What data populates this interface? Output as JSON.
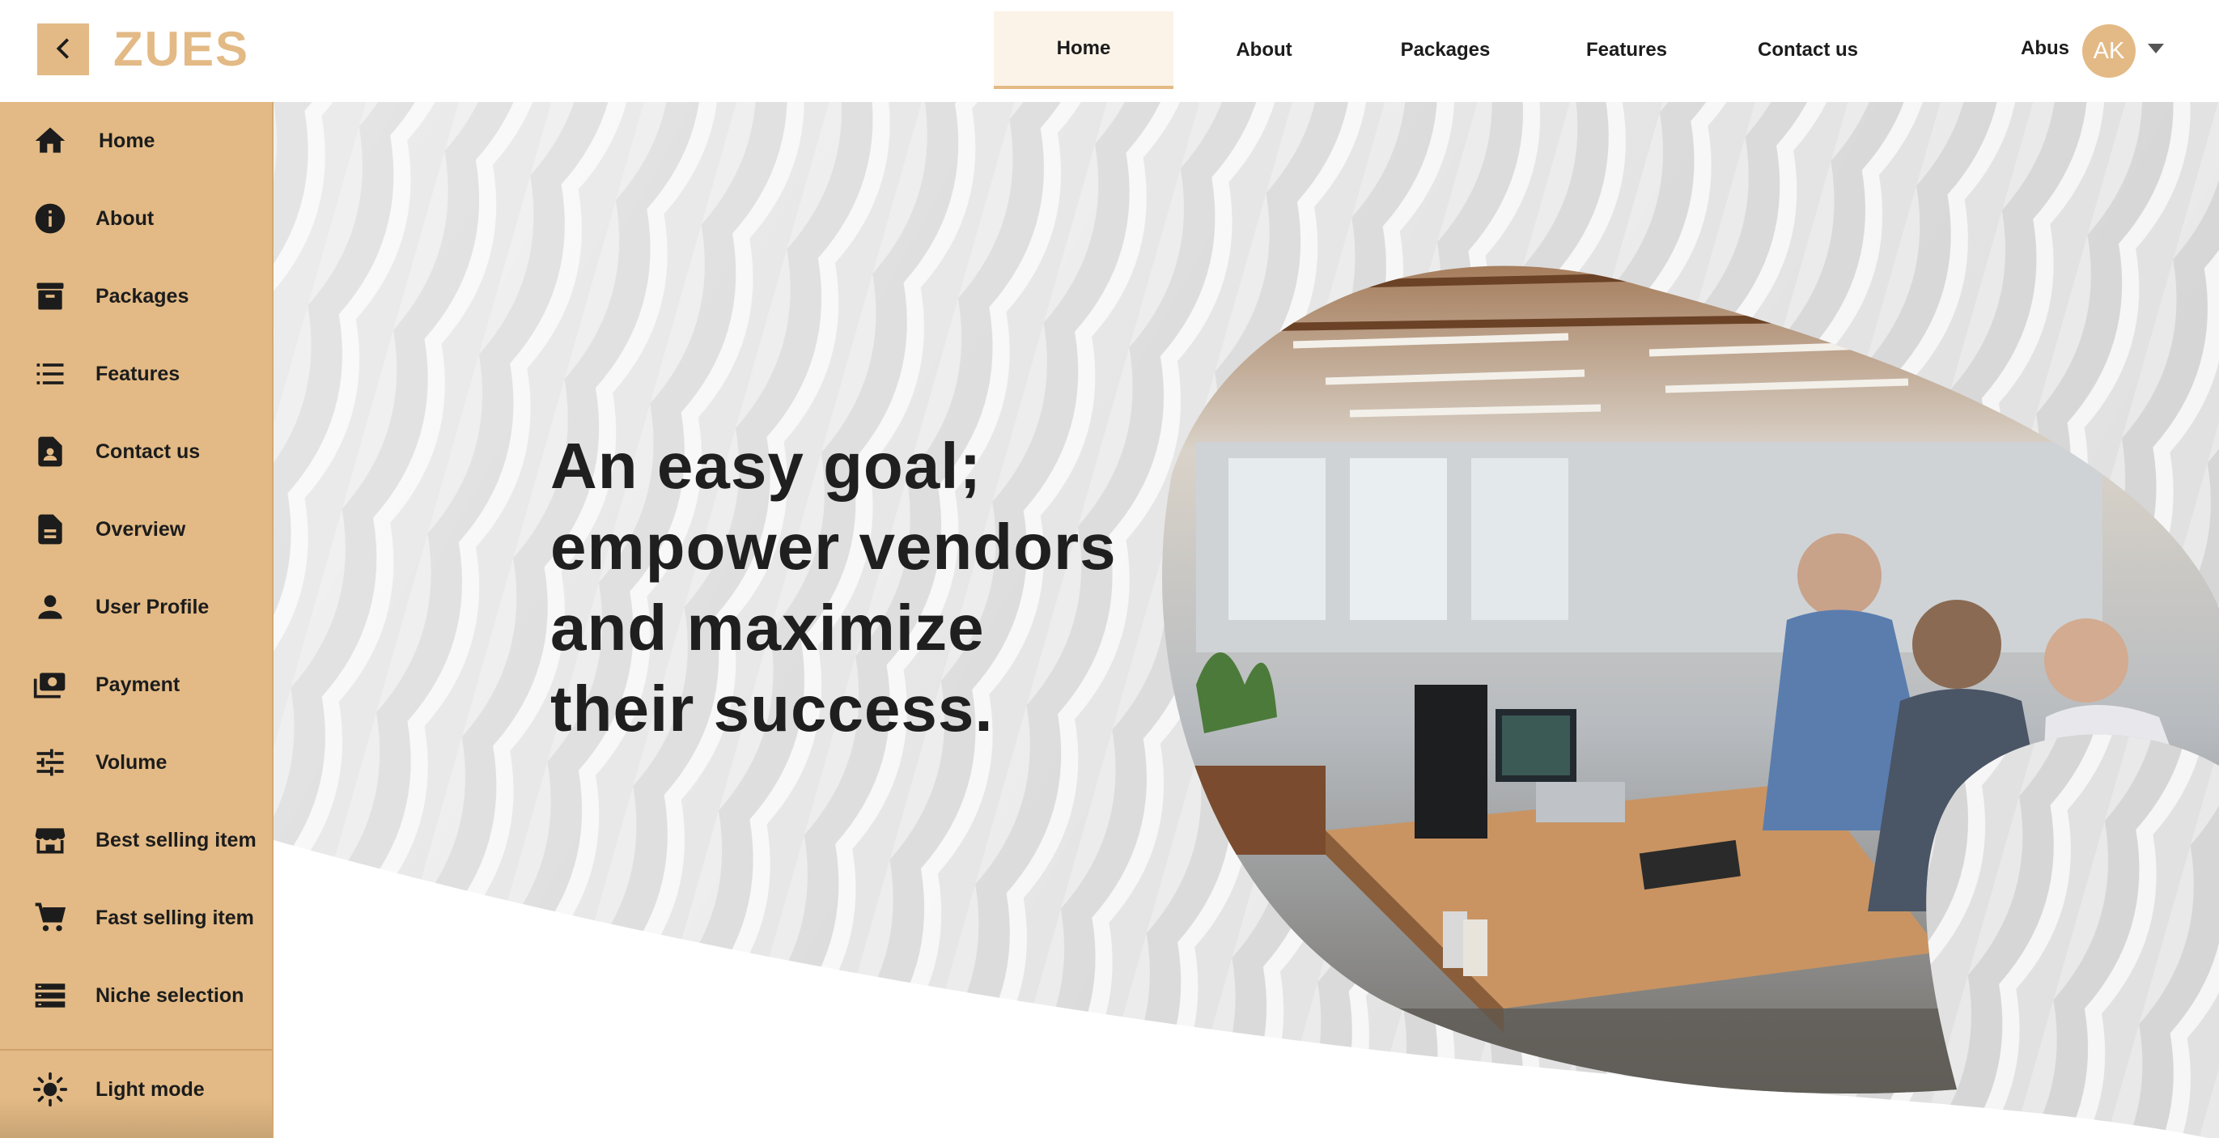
{
  "brand": {
    "name": "ZUES",
    "accent": "#e3ba85"
  },
  "header": {
    "back_icon": "chevron-left-icon",
    "tabs": [
      {
        "label": "Home",
        "active": true
      },
      {
        "label": "About",
        "active": false
      },
      {
        "label": "Packages",
        "active": false
      },
      {
        "label": "Features",
        "active": false
      },
      {
        "label": "Contact us",
        "active": false
      }
    ],
    "user": {
      "name": "Abus",
      "initials": "AK"
    }
  },
  "sidebar": {
    "items": [
      {
        "label": "Home",
        "icon": "home-icon"
      },
      {
        "label": "About",
        "icon": "info-icon"
      },
      {
        "label": "Packages",
        "icon": "archive-icon"
      },
      {
        "label": "Features",
        "icon": "list-icon"
      },
      {
        "label": "Contact us",
        "icon": "contact-icon"
      },
      {
        "label": "Overview",
        "icon": "document-icon"
      },
      {
        "label": "User Profile",
        "icon": "person-icon"
      },
      {
        "label": "Payment",
        "icon": "payment-icon"
      },
      {
        "label": "Volume",
        "icon": "sliders-icon"
      },
      {
        "label": "Best selling item",
        "icon": "store-icon"
      },
      {
        "label": "Fast selling item",
        "icon": "cart-icon"
      },
      {
        "label": "Niche selection",
        "icon": "storage-icon"
      }
    ],
    "theme_toggle": {
      "label": "Light mode",
      "icon": "sun-icon"
    }
  },
  "hero": {
    "headline_lines": [
      "An easy goal;",
      "empower vendors",
      "and maximize",
      "their success."
    ]
  }
}
